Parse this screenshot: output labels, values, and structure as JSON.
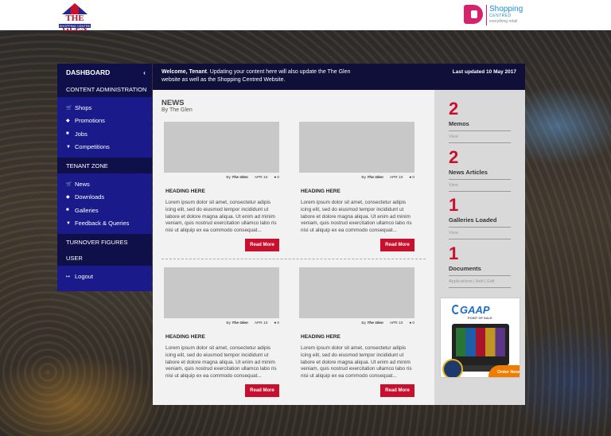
{
  "header": {
    "left_logo": {
      "name": "THE GLEN",
      "sub": "SHOPPING CENTRE"
    },
    "right_logo": {
      "line1": "Shopping",
      "line2": "CENTRED",
      "line3": "everything retail"
    }
  },
  "sidebar": {
    "title": "DASHBOARD",
    "collapse_icon": "chevron-left-icon",
    "content_admin": "CONTENT ADMINISTRATION",
    "content_items": [
      {
        "label": "Shops",
        "icon": "cart-icon"
      },
      {
        "label": "Promotions",
        "icon": "tag-icon"
      },
      {
        "label": "Jobs",
        "icon": "briefcase-icon"
      },
      {
        "label": "Competitions",
        "icon": "trophy-icon"
      }
    ],
    "tenant_zone": "TENANT ZONE",
    "tenant_items": [
      {
        "label": "News",
        "icon": "cart-icon"
      },
      {
        "label": "Downloads",
        "icon": "tag-icon"
      },
      {
        "label": "Galleries",
        "icon": "briefcase-icon"
      },
      {
        "label": "Feedback & Queries",
        "icon": "trophy-icon"
      }
    ],
    "turnover": "TURNOVER FIGURES",
    "user": "USER",
    "logout": "Logout"
  },
  "welcome": {
    "prefix": "Welcome, Tenant",
    "message": ". Updating your content here will also update the The Glen website as well as the Shopping Centred Website.",
    "last_updated": "Last updated 10 May 2017"
  },
  "news": {
    "title": "NEWS",
    "by": "By The Glen",
    "cards": [
      {
        "author_prefix": "By",
        "author": "The Glen",
        "date": "APR 10",
        "comments": "0",
        "heading": "HEADING HERE",
        "body": "Lorem ipsum dolor sit amet, consectetur adipis icing elit, sed do eiusmod tempor incididunt ut labore et dolore magna aliqua. Ut enim ad minim veniam, quis nostrud exercitation ullamco labo ris nisi ut aliquip ex ea commodo consequat...",
        "button": "Read More"
      },
      {
        "author_prefix": "By",
        "author": "The Glen",
        "date": "APR 10",
        "comments": "0",
        "heading": "HEADING HERE",
        "body": "Lorem ipsum dolor sit amet, consectetur adipis icing elit, sed do eiusmod tempor incididunt ut labore et dolore magna aliqua. Ut enim ad minim veniam, quis nostrud exercitation ullamco labo ris nisi ut aliquip ex ea commodo consequat...",
        "button": "Read More"
      },
      {
        "author_prefix": "By",
        "author": "The Glen",
        "date": "APR 10",
        "comments": "0",
        "heading": "HEADING HERE",
        "body": "Lorem ipsum dolor sit amet, consectetur adipis icing elit, sed do eiusmod tempor incididunt ut labore et dolore magna aliqua. Ut enim ad minim veniam, quis nostrud exercitation ullamco labo ris nisi ut aliquip ex ea commodo consequat...",
        "button": "Read More"
      },
      {
        "author_prefix": "By",
        "author": "The Glen",
        "date": "APR 10",
        "comments": "0",
        "heading": "HEADING HERE",
        "body": "Lorem ipsum dolor sit amet, consectetur adipis icing elit, sed do eiusmod tempor incididunt ut labore et dolore magna aliqua. Ut enim ad minim veniam, quis nostrud exercitation ullamco labo ris nisi ut aliquip ex ea commodo consequat...",
        "button": "Read More"
      }
    ]
  },
  "stats": [
    {
      "num": "2",
      "label": "Memos",
      "link": "View"
    },
    {
      "num": "2",
      "label": "News Articles",
      "link": "View"
    },
    {
      "num": "1",
      "label": "Galleries Loaded",
      "link": "View"
    },
    {
      "num": "1",
      "label": "Documents",
      "link": "Applications  |  Add  |  Edit"
    }
  ],
  "ad": {
    "brand": "GAAP",
    "tagline": "POINT OF SALE",
    "cta": "Order Now"
  },
  "colors": {
    "accent": "#c8102e",
    "sidebar": "#1a1a8a",
    "sidebar_dark": "#0f0f4a",
    "order": "#f07d00"
  }
}
